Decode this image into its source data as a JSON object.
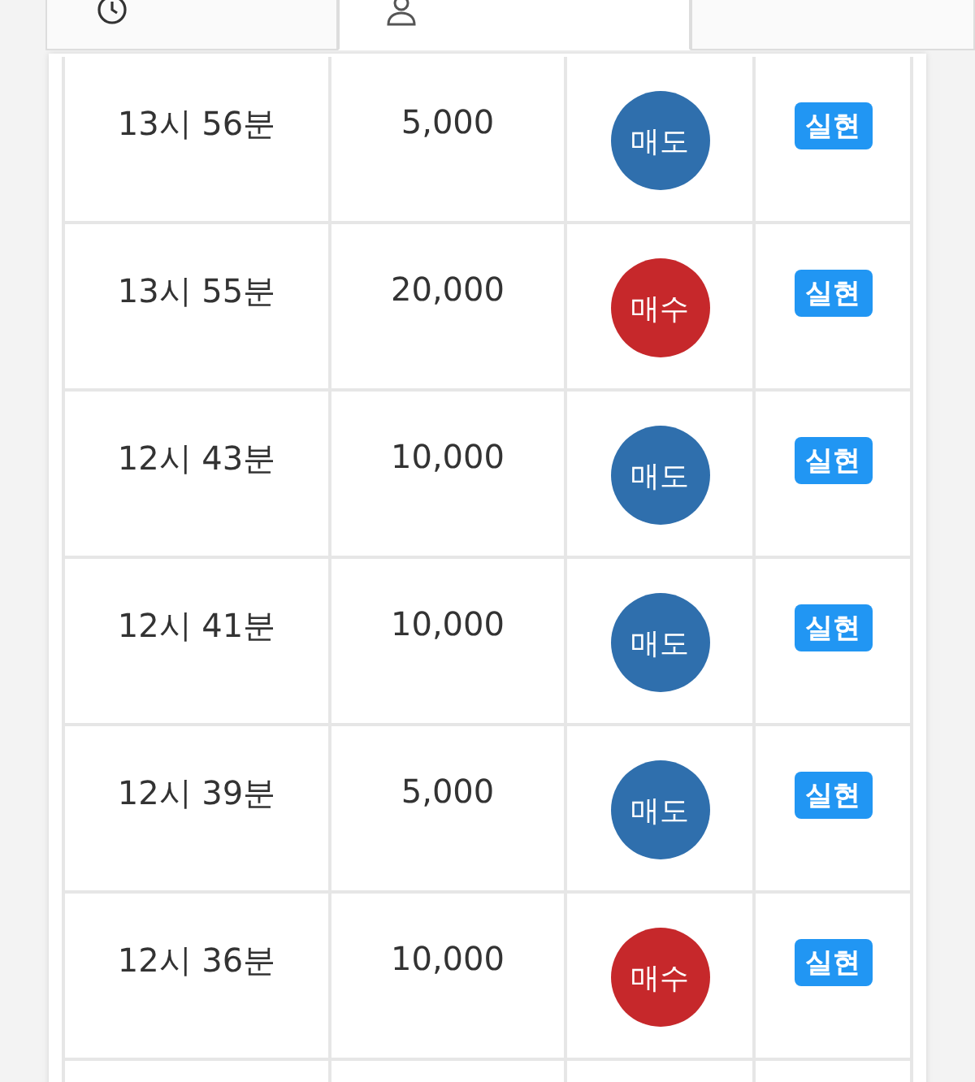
{
  "tabs": [
    {
      "kind": "history",
      "selected": false
    },
    {
      "kind": "mine",
      "selected": true
    },
    {
      "kind": "other",
      "selected": false
    }
  ],
  "trades": [
    {
      "time": "13시 56분",
      "amount": "5,000",
      "side": {
        "kind": "sell",
        "label": "매도"
      },
      "status": "실현"
    },
    {
      "time": "13시 55분",
      "amount": "20,000",
      "side": {
        "kind": "buy",
        "label": "매수"
      },
      "status": "실현"
    },
    {
      "time": "12시 43분",
      "amount": "10,000",
      "side": {
        "kind": "sell",
        "label": "매도"
      },
      "status": "실현"
    },
    {
      "time": "12시 41분",
      "amount": "10,000",
      "side": {
        "kind": "sell",
        "label": "매도"
      },
      "status": "실현"
    },
    {
      "time": "12시 39분",
      "amount": "5,000",
      "side": {
        "kind": "sell",
        "label": "매도"
      },
      "status": "실현"
    },
    {
      "time": "12시 36분",
      "amount": "10,000",
      "side": {
        "kind": "buy",
        "label": "매수"
      },
      "status": "실현"
    }
  ]
}
